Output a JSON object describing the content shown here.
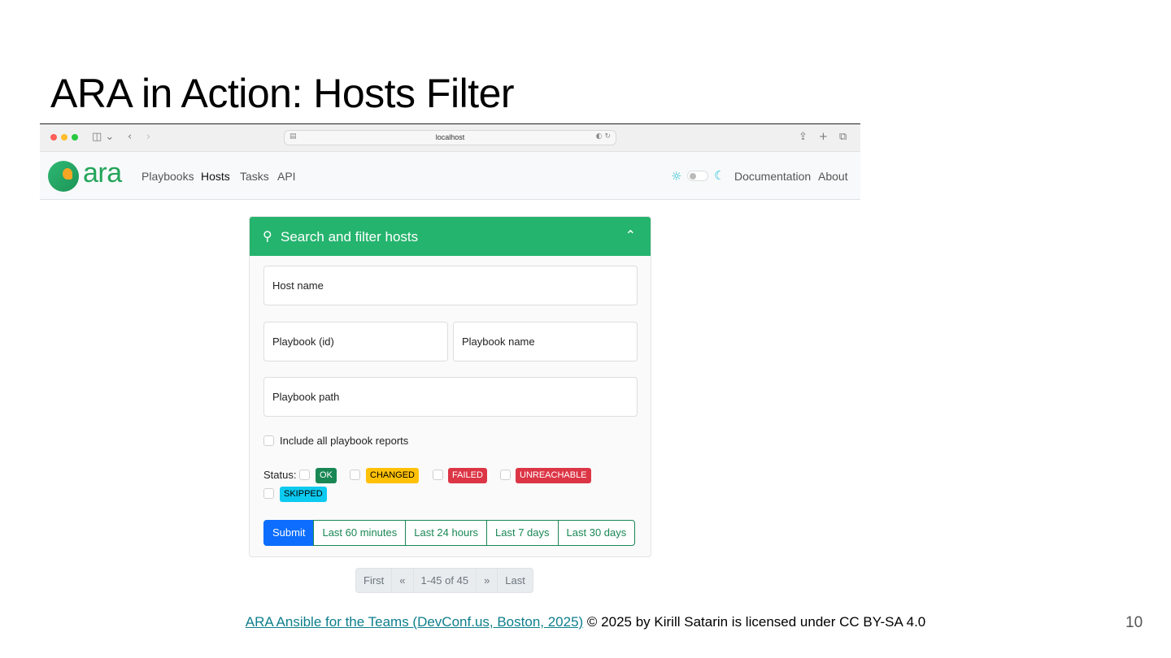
{
  "slide": {
    "title": "ARA in Action: Hosts Filter",
    "page_number": "10",
    "footer_link": "ARA Ansible for the Teams (DevConf.us, Boston, 2025)",
    "footer_text": " © 2025 by Kirill Satarin is licensed under CC BY-SA 4.0"
  },
  "browser": {
    "url": "localhost"
  },
  "navbar": {
    "logo_text": "ara",
    "links": [
      "Playbooks",
      "Hosts",
      "Tasks",
      "API"
    ],
    "active_link": "Hosts",
    "right_links": [
      "Documentation",
      "About"
    ]
  },
  "filter_panel": {
    "title": "Search and filter hosts",
    "host_name_placeholder": "Host name",
    "playbook_id_placeholder": "Playbook (id)",
    "playbook_name_placeholder": "Playbook name",
    "playbook_path_placeholder": "Playbook path",
    "include_all_label": "Include all playbook reports",
    "status_label": "Status:",
    "statuses": [
      "OK",
      "CHANGED",
      "FAILED",
      "UNREACHABLE",
      "SKIPPED"
    ],
    "buttons": {
      "submit": "Submit",
      "last_60": "Last 60 minutes",
      "last_24": "Last 24 hours",
      "last_7": "Last 7 days",
      "last_30": "Last 30 days"
    }
  },
  "pagination": {
    "first": "First",
    "prev": "«",
    "range": "1-45 of 45",
    "next": "»",
    "last": "Last"
  },
  "colors": {
    "brand_green": "#25b46e",
    "submit_blue": "#0d6efd",
    "ok": "#198754",
    "changed": "#ffc107",
    "failed": "#dc3545",
    "skipped": "#0dcaf0"
  }
}
